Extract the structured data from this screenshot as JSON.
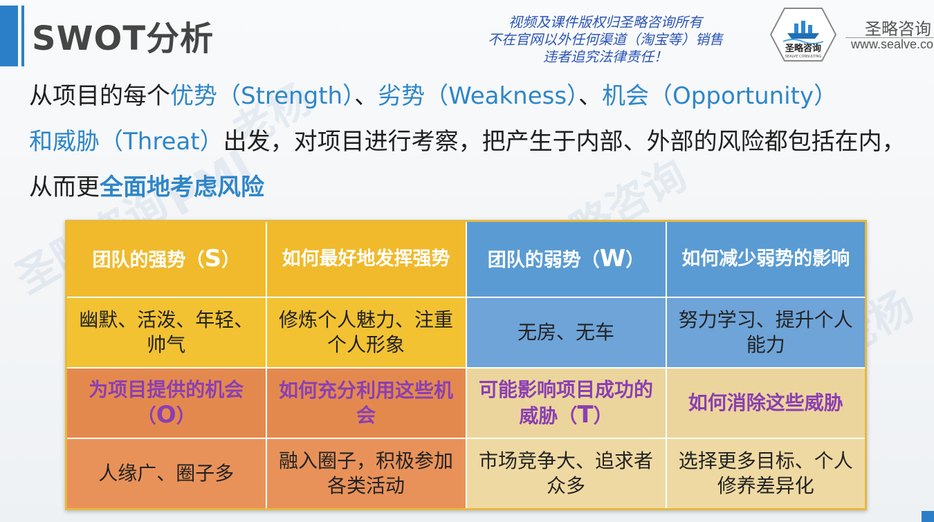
{
  "header": {
    "title": "SWOT分析",
    "notice_lines": [
      "视频及课件版权归圣略咨询所有",
      "不在官网以外任何渠道（淘宝等）销售",
      "违者追究法律责任！"
    ],
    "brand_name": "圣略咨询",
    "brand_url": "www.sealve.co",
    "logo_text": "圣略咨询",
    "logo_subtext": "SEALVE CONSULTING"
  },
  "intro": {
    "p1": "从项目的每个",
    "strength": "优势（Strength）",
    "sep1": "、",
    "weakness": "劣势（Weakness）",
    "sep2": "、",
    "opportunity": "机会（Opportunity）",
    "and": "和",
    "threat": "威胁（Threat）",
    "p2": "出发，对项目进行考察，把产生于内部、外部的风险都包括在内，从而更",
    "emphasis": "全面地考虑风险"
  },
  "watermarks": [
    "圣略咨询",
    "PMI",
    "老杨",
    "圣略咨询",
    "老杨"
  ],
  "table": {
    "s_head_pre": "团队的强势（",
    "s_letter": "S",
    "s_head_post": "）",
    "s_leverage": "如何最好地发挥强势",
    "w_head_pre": "团队的弱势（",
    "w_letter": "W",
    "w_head_post": "）",
    "w_reduce": "如何减少弱势的影响",
    "s_content": "幽默、活泼、年轻、帅气",
    "s_action": "修炼个人魅力、注重个人形象",
    "w_content": "无房、无车",
    "w_action": "努力学习、提升个人能力",
    "o_head_pre": "为项目提供的机会（",
    "o_letter": "O",
    "o_head_post": "）",
    "o_use": "如何充分利用这些机会",
    "t_head_pre": "可能影响项目成功的威胁（",
    "t_letter": "T",
    "t_head_post": "）",
    "t_eliminate": "如何消除这些威胁",
    "o_content": "人缘广、圈子多",
    "o_action": "融入圈子，积极参加各类活动",
    "t_content": "市场竞争大、追求者众多",
    "t_action": "选择更多目标、个人修养差异化"
  },
  "colors": {
    "accent": "#2b7fc8",
    "strength": "#f0ba2c",
    "weakness": "#5a9bd3",
    "opportunity": "#e4894e",
    "threat": "#ecd59c",
    "purple_text": "#8a3fb3"
  }
}
